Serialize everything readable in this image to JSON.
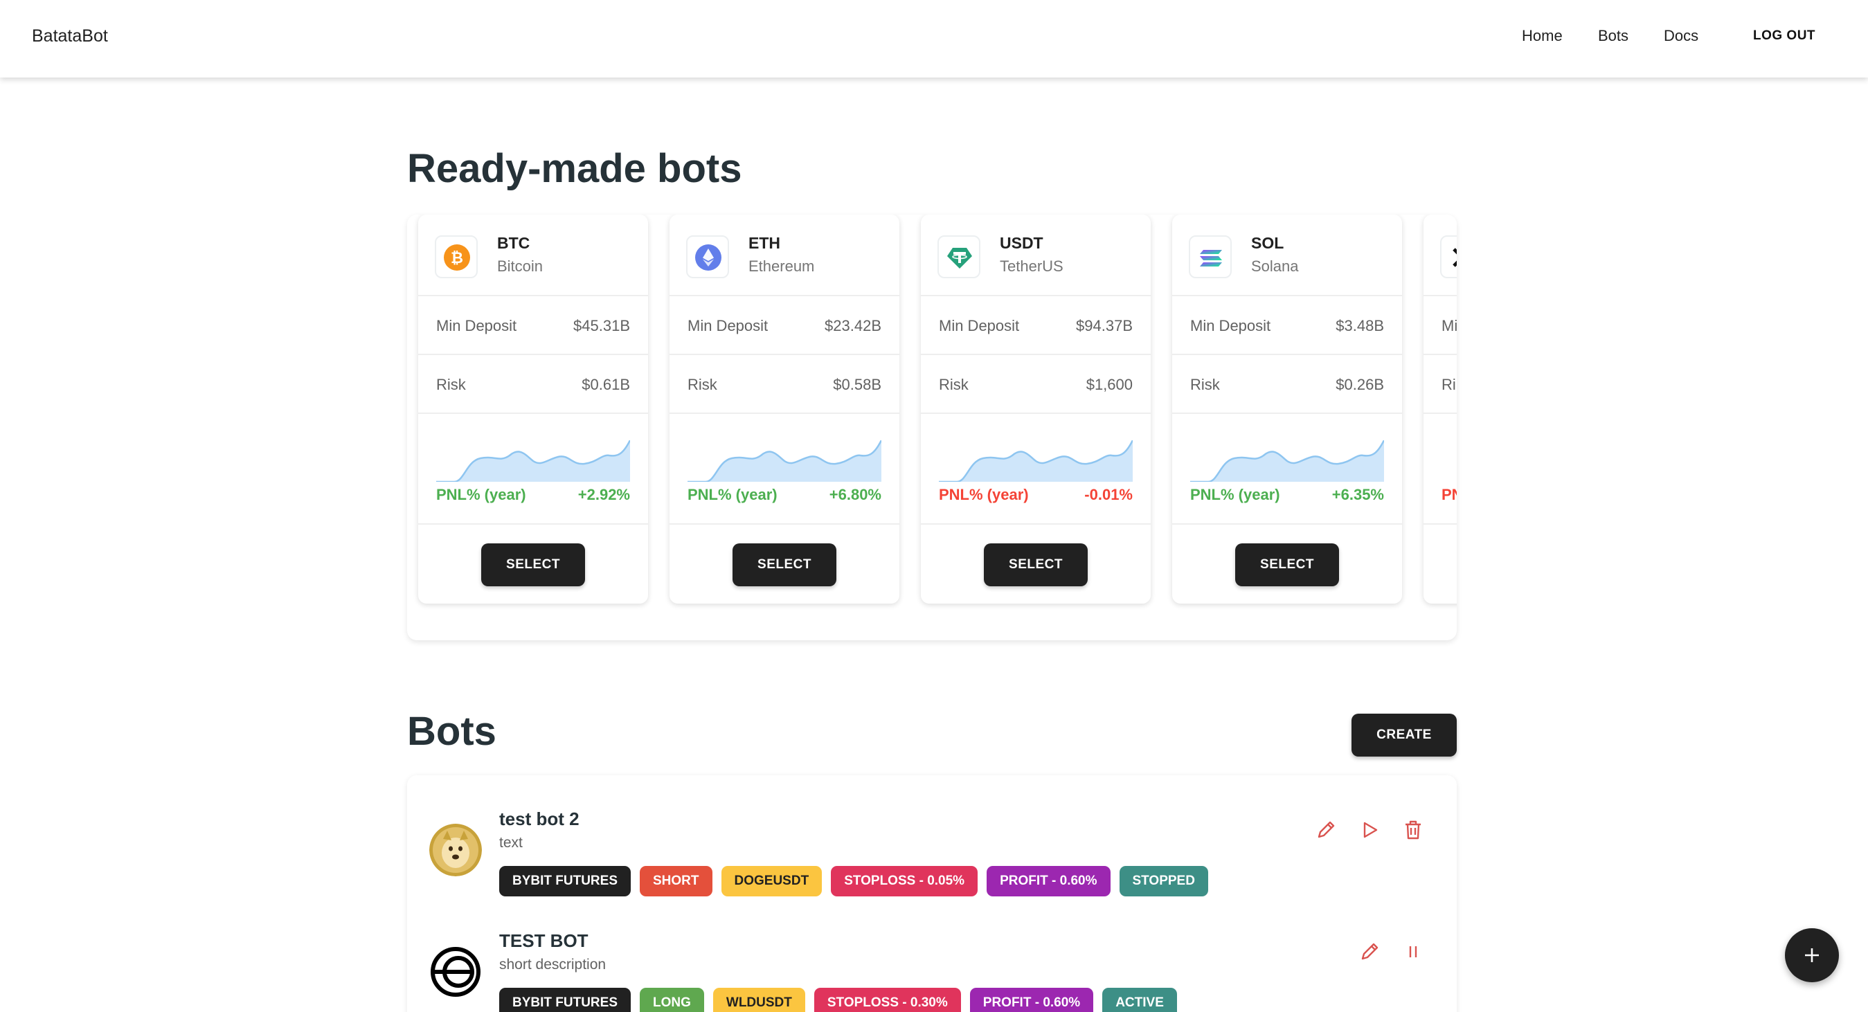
{
  "header": {
    "brand": "BatataBot",
    "nav": [
      "Home",
      "Bots",
      "Docs"
    ],
    "logout": "LOG OUT"
  },
  "ready_made": {
    "title": "Ready-made bots",
    "cards": [
      {
        "symbol": "BTC",
        "name": "Bitcoin",
        "icon": "bitcoin-icon",
        "min_deposit_label": "Min Deposit",
        "min_deposit": "$45.31B",
        "risk_label": "Risk",
        "risk": "$0.61B",
        "pnl_label": "PNL% (year)",
        "pnl": "+2.92%",
        "trend": "positive",
        "select": "SELECT"
      },
      {
        "symbol": "ETH",
        "name": "Ethereum",
        "icon": "ethereum-icon",
        "min_deposit_label": "Min Deposit",
        "min_deposit": "$23.42B",
        "risk_label": "Risk",
        "risk": "$0.58B",
        "pnl_label": "PNL% (year)",
        "pnl": "+6.80%",
        "trend": "positive",
        "select": "SELECT"
      },
      {
        "symbol": "USDT",
        "name": "TetherUS",
        "icon": "tether-icon",
        "min_deposit_label": "Min Deposit",
        "min_deposit": "$94.37B",
        "risk_label": "Risk",
        "risk": "$1,600",
        "pnl_label": "PNL% (year)",
        "pnl": "-0.01%",
        "trend": "negative",
        "select": "SELECT"
      },
      {
        "symbol": "SOL",
        "name": "Solana",
        "icon": "solana-icon",
        "min_deposit_label": "Min Deposit",
        "min_deposit": "$3.48B",
        "risk_label": "Risk",
        "risk": "$0.26B",
        "pnl_label": "PNL% (year)",
        "pnl": "+6.35%",
        "trend": "positive",
        "select": "SELECT"
      },
      {
        "symbol": "",
        "name": "",
        "icon": "x-coin-icon",
        "min_deposit_label": "Mi",
        "min_deposit": "",
        "risk_label": "Ri",
        "risk": "",
        "pnl_label": "PN",
        "pnl": "",
        "trend": "negative",
        "select": ""
      }
    ]
  },
  "bots": {
    "title": "Bots",
    "create": "CREATE",
    "items": [
      {
        "name": "test bot 2",
        "description": "text",
        "avatar": "doge-avatar",
        "chips": [
          {
            "label": "BYBIT FUTURES",
            "color": "#212121"
          },
          {
            "label": "SHORT",
            "color": "#e4503b"
          },
          {
            "label": "DOGEUSDT",
            "color": "#fbc540",
            "text": "#212121"
          },
          {
            "label": "STOPLOSS - 0.05%",
            "color": "#e0345c"
          },
          {
            "label": "PROFIT - 0.60%",
            "color": "#9c27b0"
          },
          {
            "label": "STOPPED",
            "color": "#3d8f86"
          }
        ],
        "actions": [
          "edit-icon",
          "play-icon",
          "delete-icon"
        ]
      },
      {
        "name": "TEST BOT",
        "description": "short description",
        "avatar": "worldcoin-avatar",
        "chips": [
          {
            "label": "BYBIT FUTURES",
            "color": "#212121"
          },
          {
            "label": "LONG",
            "color": "#5fa84f"
          },
          {
            "label": "WLDUSDT",
            "color": "#fbc540",
            "text": "#212121"
          },
          {
            "label": "STOPLOSS - 0.30%",
            "color": "#e0345c"
          },
          {
            "label": "PROFIT - 0.60%",
            "color": "#9c27b0"
          },
          {
            "label": "ACTIVE",
            "color": "#3d8f86"
          }
        ],
        "actions": [
          "edit-icon",
          "pause-icon"
        ]
      }
    ]
  },
  "fab": "add-icon"
}
